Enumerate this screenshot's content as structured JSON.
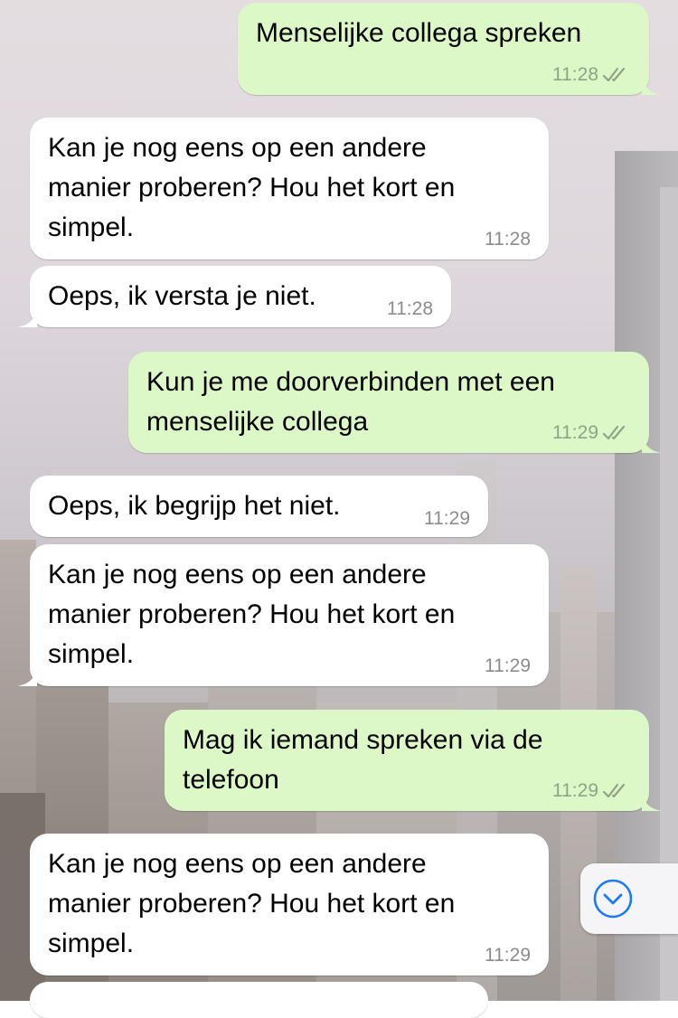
{
  "messages": [
    {
      "direction": "out",
      "text": "Menselijke collega spreken",
      "time": "11:28",
      "status": "read"
    },
    {
      "direction": "in",
      "text": "Kan je nog eens op een andere\nmanier proberen? Hou het kort en\nsimpel.",
      "time": "11:28"
    },
    {
      "direction": "in",
      "text": "Oeps, ik versta je niet.",
      "time": "11:28"
    },
    {
      "direction": "out",
      "text": "Kun je me doorverbinden met een\nmenselijke collega",
      "time": "11:29",
      "status": "read"
    },
    {
      "direction": "in",
      "text": "Oeps, ik begrijp het niet.",
      "time": "11:29"
    },
    {
      "direction": "in",
      "text": "Kan je nog eens op een andere\nmanier proberen? Hou het kort en\nsimpel.",
      "time": "11:29"
    },
    {
      "direction": "out",
      "text": "Mag ik iemand spreken via de\ntelefoon",
      "time": "11:29",
      "status": "read"
    },
    {
      "direction": "in",
      "text": "Kan je nog eens op een andere\nmanier proberen? Hou het kort en\nsimpel.",
      "time": "11:29"
    }
  ],
  "scroll_button": {
    "icon": "chevron-down-circle-icon"
  },
  "colors": {
    "outgoing_bubble": "#dcf8c6",
    "incoming_bubble": "#ffffff",
    "read_ticks": "#8ea486",
    "scroll_icon": "#1a7cf5"
  }
}
